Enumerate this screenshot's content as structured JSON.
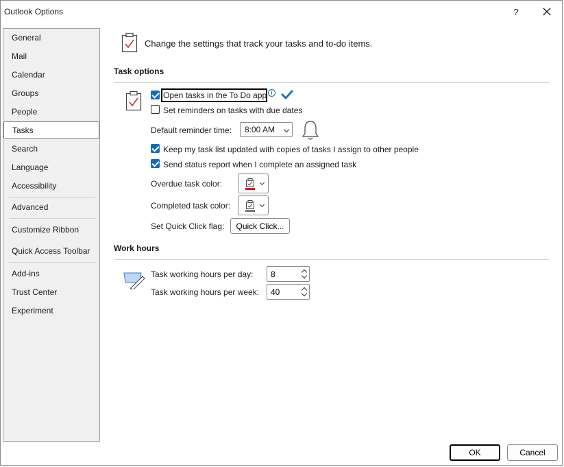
{
  "window": {
    "title": "Outlook Options",
    "help_label": "?"
  },
  "sidebar": {
    "items": [
      {
        "label": "General"
      },
      {
        "label": "Mail"
      },
      {
        "label": "Calendar"
      },
      {
        "label": "Groups"
      },
      {
        "label": "People"
      },
      {
        "label": "Tasks",
        "selected": true
      },
      {
        "label": "Search"
      },
      {
        "label": "Language"
      },
      {
        "label": "Accessibility"
      },
      {
        "label": "Advanced"
      },
      {
        "label": "Customize Ribbon"
      },
      {
        "label": "Quick Access Toolbar"
      },
      {
        "label": "Add-ins"
      },
      {
        "label": "Trust Center"
      },
      {
        "label": "Experiment"
      }
    ]
  },
  "header": {
    "text": "Change the settings that track your tasks and to-do items."
  },
  "task_options": {
    "title": "Task options",
    "open_todo": {
      "label": "Open tasks in the To Do app",
      "checked": true
    },
    "reminders": {
      "label": "Set reminders on tasks with due dates",
      "checked": false
    },
    "reminder_time": {
      "label": "Default reminder time:",
      "value": "8:00 AM"
    },
    "keep_updated": {
      "label": "Keep my task list updated with copies of tasks I assign to other people",
      "checked": true
    },
    "status_report": {
      "label": "Send status report when I complete an assigned task",
      "checked": true
    },
    "overdue_color": {
      "label": "Overdue task color:",
      "color": "#e81123"
    },
    "completed_color": {
      "label": "Completed task color:",
      "color": "#7a7a7a"
    },
    "quick_click": {
      "label": "Set Quick Click flag:",
      "button": "Quick Click..."
    }
  },
  "work_hours": {
    "title": "Work hours",
    "per_day": {
      "label": "Task working hours per day:",
      "value": "8"
    },
    "per_week": {
      "label": "Task working hours per week:",
      "value": "40"
    }
  },
  "footer": {
    "ok": "OK",
    "cancel": "Cancel"
  },
  "colors": {
    "accent": "#0f6cbd",
    "check_mark": "#1e6fc9"
  }
}
